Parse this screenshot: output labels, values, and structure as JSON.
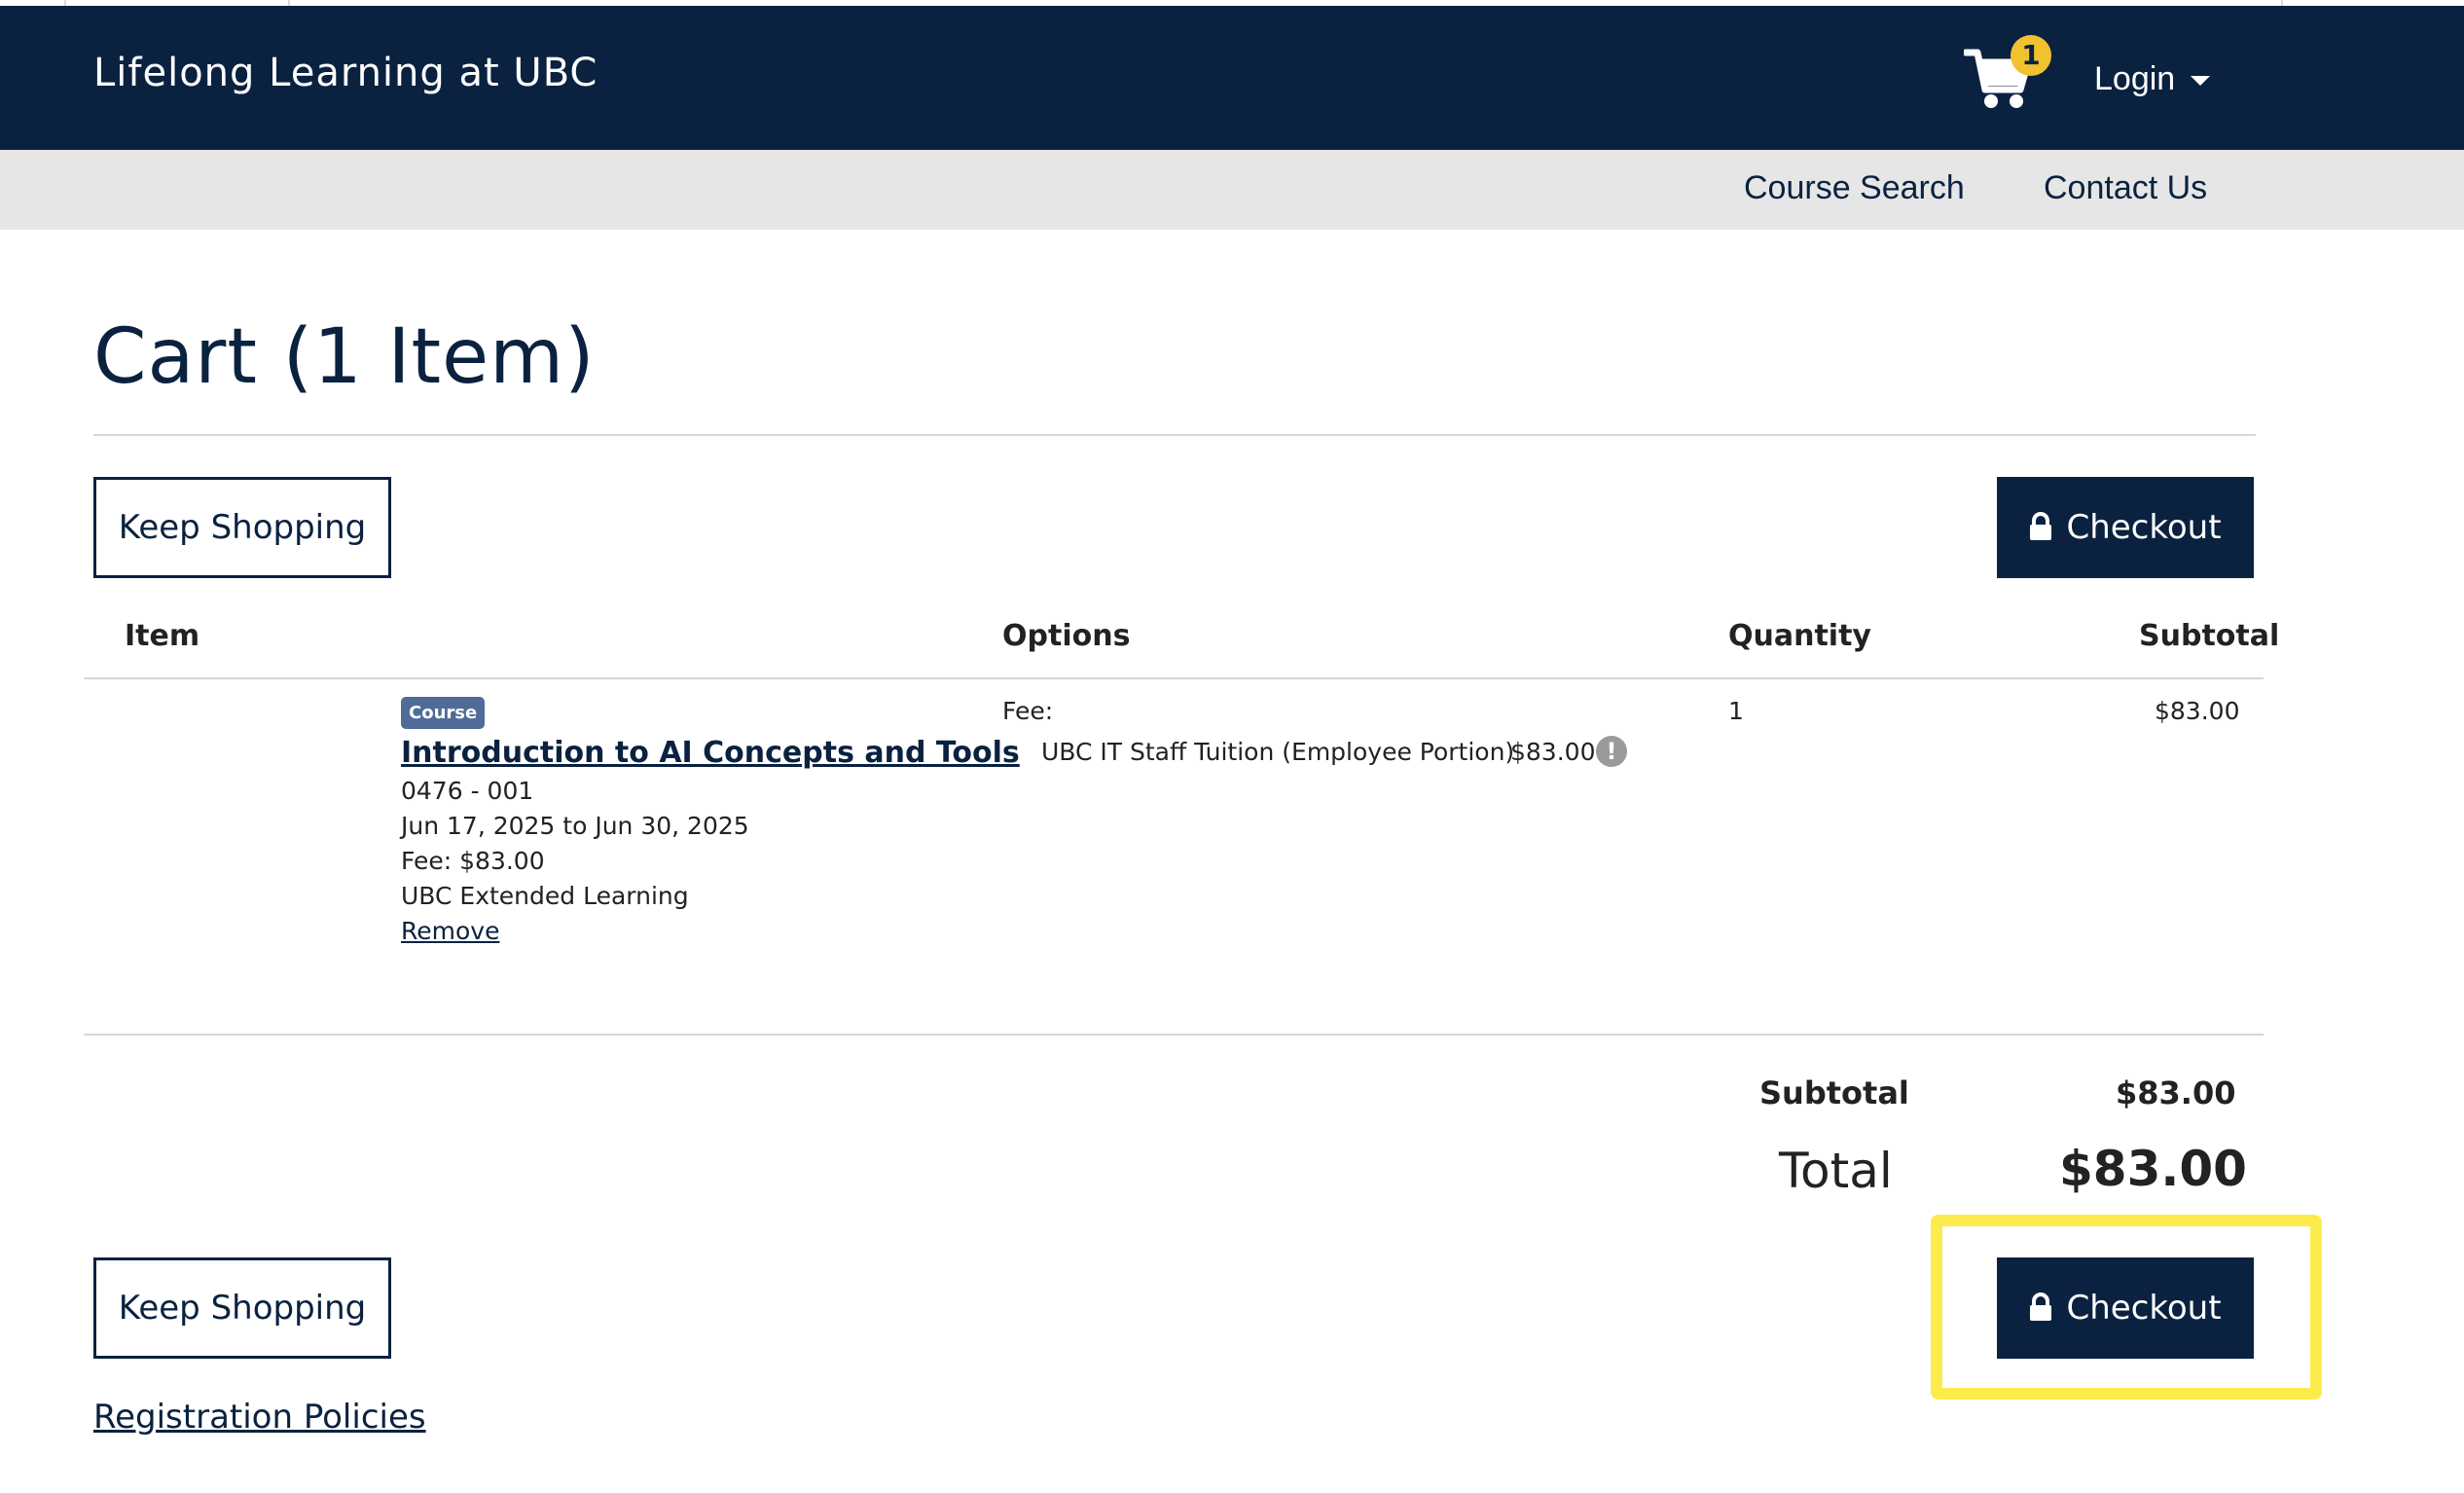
{
  "header": {
    "brand": "Lifelong Learning at UBC",
    "cart_count": "1",
    "login_label": "Login"
  },
  "subnav": {
    "items": [
      "Course Search",
      "Contact Us"
    ]
  },
  "page": {
    "title": "Cart (1 Item)",
    "keep_shopping_label": "Keep Shopping",
    "checkout_label": "Checkout",
    "registration_policies": "Registration Policies"
  },
  "table": {
    "headers": [
      "Item",
      "Options",
      "Quantity",
      "Subtotal"
    ],
    "rows": [
      {
        "badge": "Course",
        "title": "Introduction to AI Concepts and Tools",
        "section": "0476 - 001",
        "dates": "Jun 17, 2025 to Jun 30, 2025",
        "fee": "Fee: $83.00",
        "provider": "UBC Extended Learning",
        "remove_label": "Remove",
        "options_label": "Fee:",
        "option_name": "UBC IT Staff Tuition (Employee Portion)",
        "option_price": "$83.00",
        "quantity": "1",
        "subtotal": "$83.00"
      }
    ]
  },
  "summary": {
    "subtotal_label": "Subtotal",
    "subtotal_value": "$83.00",
    "total_label": "Total",
    "total_value": "$83.00"
  },
  "colors": {
    "brand_navy": "#0a2240",
    "highlight_yellow": "#fdeb4b",
    "badge_yellow": "#f2c12e"
  }
}
